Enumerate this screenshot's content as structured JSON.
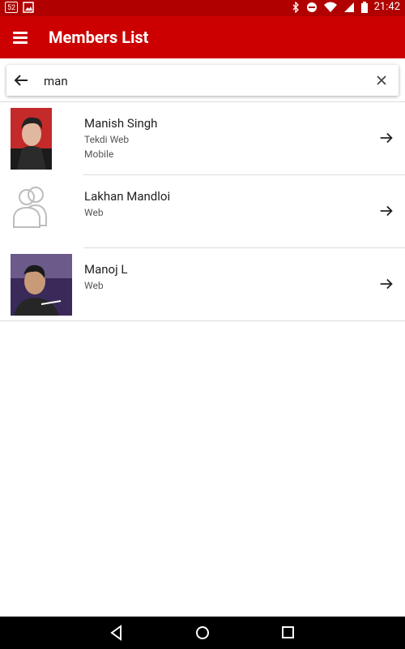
{
  "status_bar": {
    "time": "21:42",
    "left_badge": "52"
  },
  "app_bar": {
    "title": "Members List"
  },
  "search": {
    "value": "man",
    "placeholder": ""
  },
  "members": [
    {
      "name": "Manish Singh",
      "lines": [
        "Tekdi Web",
        "Mobile"
      ],
      "avatar": "photo"
    },
    {
      "name": "Lakhan Mandloi",
      "lines": [
        "Web"
      ],
      "avatar": "generic-group-icon"
    },
    {
      "name": "Manoj L",
      "lines": [
        "Web"
      ],
      "avatar": "photo"
    }
  ],
  "colors": {
    "status_bar": "#b00000",
    "app_bar": "#cc0000"
  }
}
